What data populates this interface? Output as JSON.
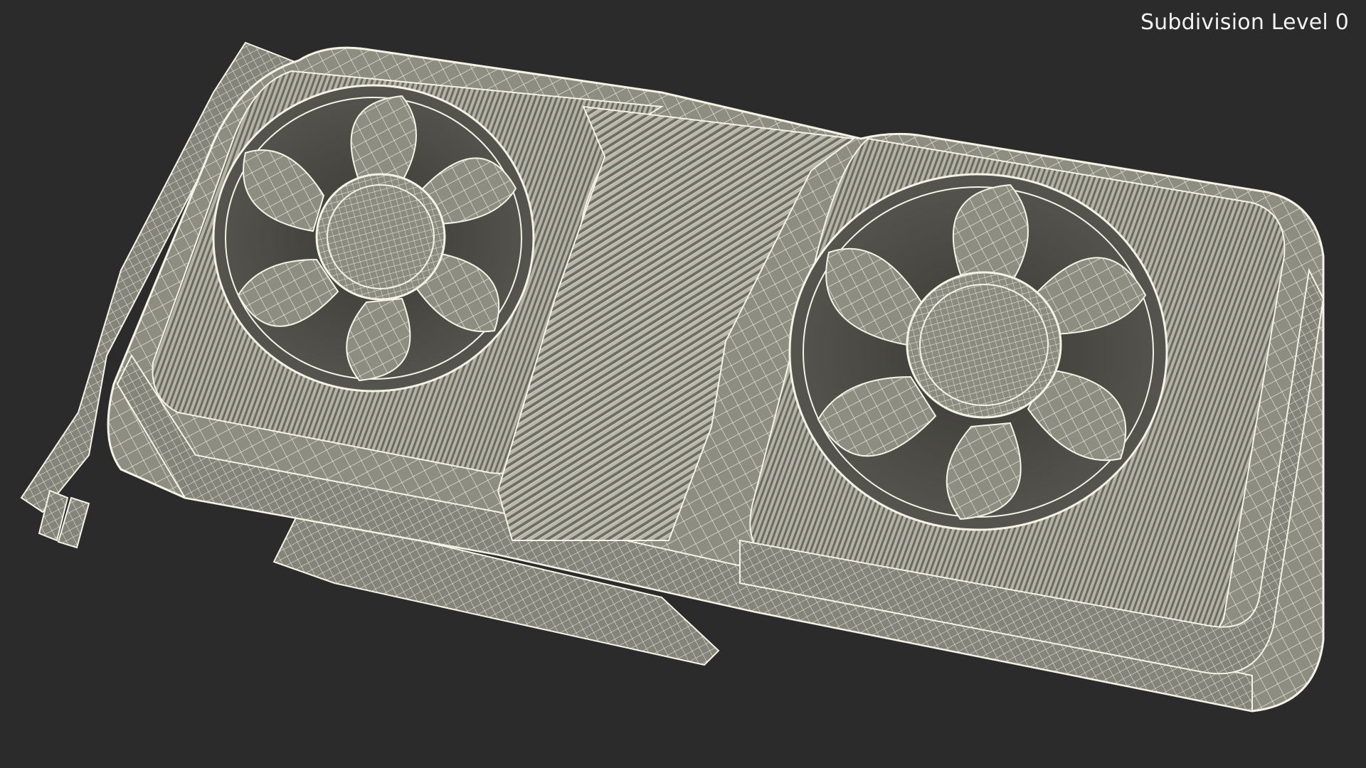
{
  "viewport": {
    "overlay_label": "Subdivision Level 0",
    "background_color": "#2b2b2b",
    "model_surface_color": "#908f83",
    "wire_color": "#f4f3e6"
  }
}
